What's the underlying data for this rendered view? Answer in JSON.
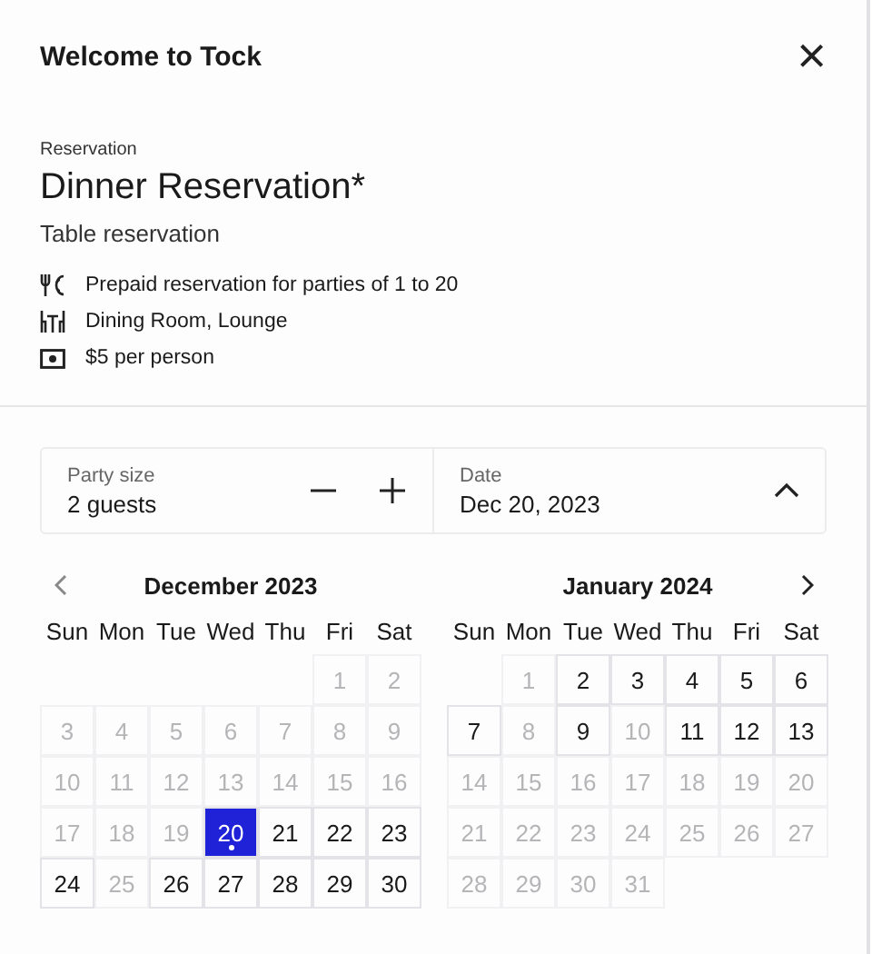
{
  "header": {
    "title": "Welcome to Tock",
    "close": "×"
  },
  "experience": {
    "overline": "Reservation",
    "title": "Dinner Reservation*",
    "subtitle": "Table reservation",
    "details": [
      {
        "kind": "dining",
        "text": "Prepaid reservation for parties of 1 to 20"
      },
      {
        "kind": "room",
        "text": "Dining Room, Lounge"
      },
      {
        "kind": "money",
        "text": "$5 per person"
      }
    ]
  },
  "party": {
    "label": "Party size",
    "value": "2 guests"
  },
  "date": {
    "label": "Date",
    "value": "Dec 20, 2023",
    "expanded": true
  },
  "months": [
    {
      "title": "December 2023",
      "weekdays": [
        "Sun",
        "Mon",
        "Tue",
        "Wed",
        "Thu",
        "Fri",
        "Sat"
      ],
      "days": [
        {
          "kind": "blank"
        },
        {
          "kind": "blank"
        },
        {
          "kind": "blank"
        },
        {
          "kind": "blank"
        },
        {
          "kind": "blank"
        },
        {
          "kind": "day",
          "text": "1",
          "disabled": true,
          "selected": false
        },
        {
          "kind": "day",
          "text": "2",
          "disabled": true,
          "selected": false
        },
        {
          "kind": "day",
          "text": "3",
          "disabled": true,
          "selected": false
        },
        {
          "kind": "day",
          "text": "4",
          "disabled": true,
          "selected": false
        },
        {
          "kind": "day",
          "text": "5",
          "disabled": true,
          "selected": false
        },
        {
          "kind": "day",
          "text": "6",
          "disabled": true,
          "selected": false
        },
        {
          "kind": "day",
          "text": "7",
          "disabled": true,
          "selected": false
        },
        {
          "kind": "day",
          "text": "8",
          "disabled": true,
          "selected": false
        },
        {
          "kind": "day",
          "text": "9",
          "disabled": true,
          "selected": false
        },
        {
          "kind": "day",
          "text": "10",
          "disabled": true,
          "selected": false
        },
        {
          "kind": "day",
          "text": "11",
          "disabled": true,
          "selected": false
        },
        {
          "kind": "day",
          "text": "12",
          "disabled": true,
          "selected": false
        },
        {
          "kind": "day",
          "text": "13",
          "disabled": true,
          "selected": false
        },
        {
          "kind": "day",
          "text": "14",
          "disabled": true,
          "selected": false
        },
        {
          "kind": "day",
          "text": "15",
          "disabled": true,
          "selected": false
        },
        {
          "kind": "day",
          "text": "16",
          "disabled": true,
          "selected": false
        },
        {
          "kind": "day",
          "text": "17",
          "disabled": true,
          "selected": false
        },
        {
          "kind": "day",
          "text": "18",
          "disabled": true,
          "selected": false
        },
        {
          "kind": "day",
          "text": "19",
          "disabled": true,
          "selected": false
        },
        {
          "kind": "day",
          "text": "20",
          "disabled": false,
          "selected": true
        },
        {
          "kind": "day",
          "text": "21",
          "disabled": false,
          "selected": false
        },
        {
          "kind": "day",
          "text": "22",
          "disabled": false,
          "selected": false
        },
        {
          "kind": "day",
          "text": "23",
          "disabled": false,
          "selected": false
        },
        {
          "kind": "day",
          "text": "24",
          "disabled": false,
          "selected": false
        },
        {
          "kind": "day",
          "text": "25",
          "disabled": true,
          "selected": false
        },
        {
          "kind": "day",
          "text": "26",
          "disabled": false,
          "selected": false
        },
        {
          "kind": "day",
          "text": "27",
          "disabled": false,
          "selected": false
        },
        {
          "kind": "day",
          "text": "28",
          "disabled": false,
          "selected": false
        },
        {
          "kind": "day",
          "text": "29",
          "disabled": false,
          "selected": false
        },
        {
          "kind": "day",
          "text": "30",
          "disabled": false,
          "selected": false
        }
      ]
    },
    {
      "title": "January 2024",
      "weekdays": [
        "Sun",
        "Mon",
        "Tue",
        "Wed",
        "Thu",
        "Fri",
        "Sat"
      ],
      "days": [
        {
          "kind": "blank"
        },
        {
          "kind": "day",
          "text": "1",
          "disabled": true,
          "selected": false
        },
        {
          "kind": "day",
          "text": "2",
          "disabled": false,
          "selected": false
        },
        {
          "kind": "day",
          "text": "3",
          "disabled": false,
          "selected": false
        },
        {
          "kind": "day",
          "text": "4",
          "disabled": false,
          "selected": false
        },
        {
          "kind": "day",
          "text": "5",
          "disabled": false,
          "selected": false
        },
        {
          "kind": "day",
          "text": "6",
          "disabled": false,
          "selected": false
        },
        {
          "kind": "day",
          "text": "7",
          "disabled": false,
          "selected": false
        },
        {
          "kind": "day",
          "text": "8",
          "disabled": true,
          "selected": false
        },
        {
          "kind": "day",
          "text": "9",
          "disabled": false,
          "selected": false
        },
        {
          "kind": "day",
          "text": "10",
          "disabled": true,
          "selected": false
        },
        {
          "kind": "day",
          "text": "11",
          "disabled": false,
          "selected": false
        },
        {
          "kind": "day",
          "text": "12",
          "disabled": false,
          "selected": false
        },
        {
          "kind": "day",
          "text": "13",
          "disabled": false,
          "selected": false
        },
        {
          "kind": "day",
          "text": "14",
          "disabled": true,
          "selected": false
        },
        {
          "kind": "day",
          "text": "15",
          "disabled": true,
          "selected": false
        },
        {
          "kind": "day",
          "text": "16",
          "disabled": true,
          "selected": false
        },
        {
          "kind": "day",
          "text": "17",
          "disabled": true,
          "selected": false
        },
        {
          "kind": "day",
          "text": "18",
          "disabled": true,
          "selected": false
        },
        {
          "kind": "day",
          "text": "19",
          "disabled": true,
          "selected": false
        },
        {
          "kind": "day",
          "text": "20",
          "disabled": true,
          "selected": false
        },
        {
          "kind": "day",
          "text": "21",
          "disabled": true,
          "selected": false
        },
        {
          "kind": "day",
          "text": "22",
          "disabled": true,
          "selected": false
        },
        {
          "kind": "day",
          "text": "23",
          "disabled": true,
          "selected": false
        },
        {
          "kind": "day",
          "text": "24",
          "disabled": true,
          "selected": false
        },
        {
          "kind": "day",
          "text": "25",
          "disabled": true,
          "selected": false
        },
        {
          "kind": "day",
          "text": "26",
          "disabled": true,
          "selected": false
        },
        {
          "kind": "day",
          "text": "27",
          "disabled": true,
          "selected": false
        },
        {
          "kind": "day",
          "text": "28",
          "disabled": true,
          "selected": false
        },
        {
          "kind": "day",
          "text": "29",
          "disabled": true,
          "selected": false
        },
        {
          "kind": "day",
          "text": "30",
          "disabled": true,
          "selected": false
        },
        {
          "kind": "day",
          "text": "31",
          "disabled": true,
          "selected": false
        }
      ]
    }
  ]
}
